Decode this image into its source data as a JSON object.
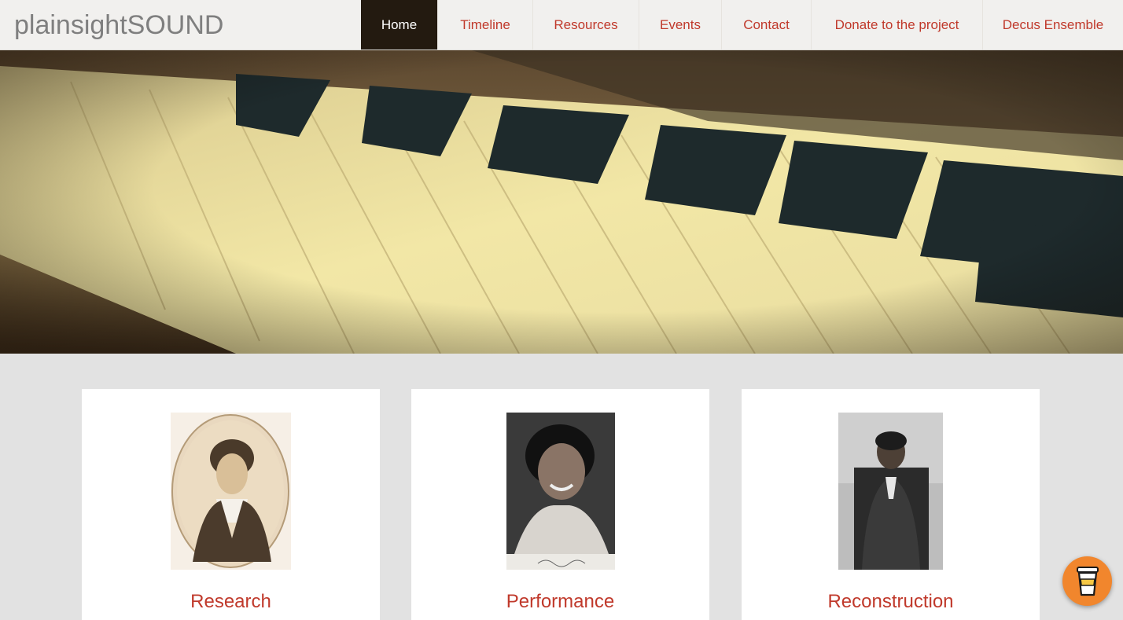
{
  "brand": "plainsightSOUND",
  "nav": {
    "items": [
      {
        "label": "Home",
        "active": true
      },
      {
        "label": "Timeline",
        "active": false
      },
      {
        "label": "Resources",
        "active": false
      },
      {
        "label": "Events",
        "active": false
      },
      {
        "label": "Contact",
        "active": false
      },
      {
        "label": "Donate to the project",
        "active": false
      },
      {
        "label": "Decus Ensemble",
        "active": false
      }
    ]
  },
  "hero": {
    "image": "piano-keys-photo"
  },
  "cards": [
    {
      "title": "Research",
      "image": "oval-engraved-portrait"
    },
    {
      "title": "Performance",
      "image": "smiling-singer-photo"
    },
    {
      "title": "Reconstruction",
      "image": "seated-composer-photo"
    }
  ],
  "floating_button": {
    "icon": "coffee-cup-icon"
  },
  "colors": {
    "accent": "#c0392b",
    "nav_active_bg": "#231a10",
    "page_bg": "#e2e2e2",
    "coffee_button": "#f1862d"
  }
}
